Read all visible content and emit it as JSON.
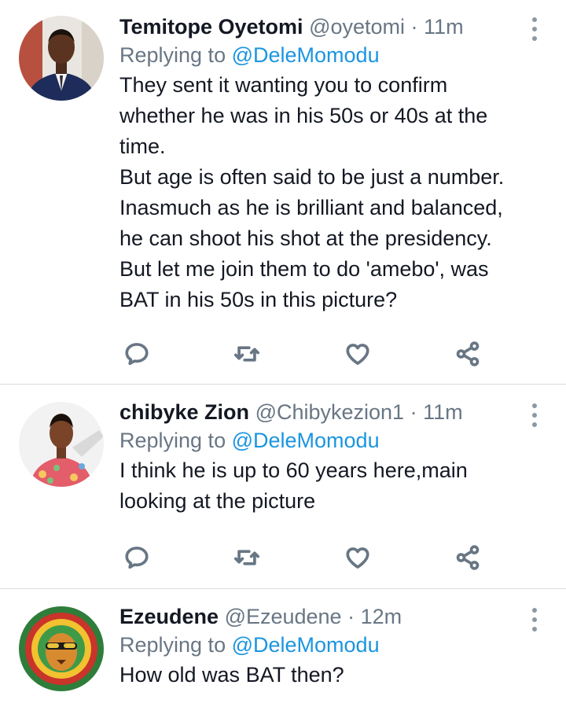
{
  "tweets": [
    {
      "name": "Temitope Oyetomi",
      "handle": "@oyetomi",
      "separator": "·",
      "time": "11m",
      "replying_prefix": "Replying to",
      "replying_to": "@DeleMomodu",
      "text": "They sent it wanting you to confirm\nwhether he was in his 50s or 40s at the\ntime.\nBut age is often said to be just a number.\nInasmuch as he is brilliant and balanced,\nhe can shoot his shot at the presidency.\nBut let me join them to do 'amebo', was\nBAT in his 50s in this picture?",
      "avatar": "man-in-suit-avatar"
    },
    {
      "name": "chibyke Zion",
      "handle": "@Chibykezion1",
      "separator": "·",
      "time": "11m",
      "replying_prefix": "Replying to",
      "replying_to": "@DeleMomodu",
      "text": "I think he is up to 60 years here,main\nlooking at the picture",
      "avatar": "man-in-floral-shirt-avatar"
    },
    {
      "name": "Ezeudene",
      "handle": "@Ezeudene",
      "separator": "·",
      "time": "12m",
      "replying_prefix": "Replying to",
      "replying_to": "@DeleMomodu",
      "text": "How old was BAT then?",
      "avatar": "rasta-lion-avatar"
    }
  ],
  "action_icons": [
    "reply-icon",
    "retweet-icon",
    "like-icon",
    "share-icon"
  ],
  "colors": {
    "text": "#141823",
    "secondary": "#687684",
    "mention": "#1b95e0",
    "divider": "#d9dee3"
  }
}
